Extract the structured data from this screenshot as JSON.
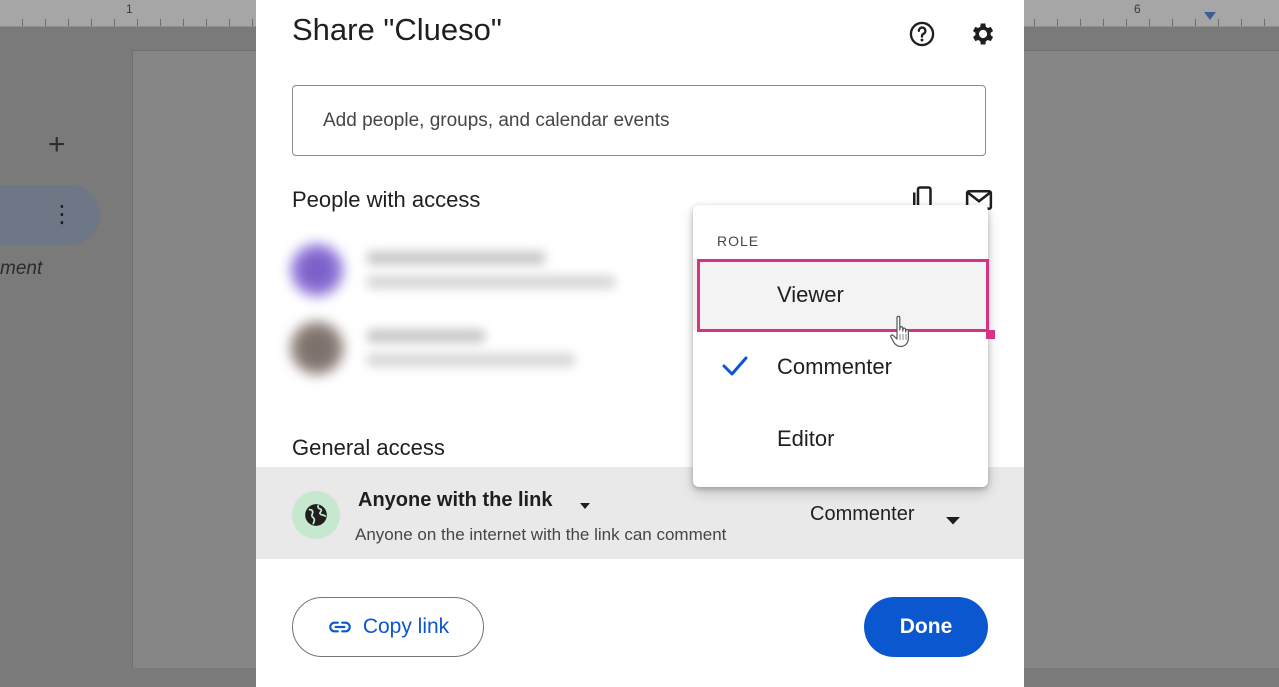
{
  "background": {
    "ruler": {
      "left_number": "1",
      "right_number": "6"
    },
    "comment_text": "ment"
  },
  "dialog": {
    "title": "Share \"Clueso\"",
    "help_icon": "help-circle-icon",
    "settings_icon": "gear-icon",
    "add_people_placeholder": "Add people, groups, and calendar events",
    "people_section_title": "People with access",
    "general_section_title": "General access",
    "general_access": {
      "type_label": "Anyone with the link",
      "description": "Anyone on the internet with the link can comment",
      "role_label": "Commenter"
    },
    "copy_link_label": "Copy link",
    "done_label": "Done"
  },
  "role_menu": {
    "header": "ROLE",
    "items": [
      {
        "label": "Viewer",
        "checked": false,
        "hovered": true
      },
      {
        "label": "Commenter",
        "checked": true,
        "hovered": false
      },
      {
        "label": "Editor",
        "checked": false,
        "hovered": false
      }
    ]
  },
  "colors": {
    "primary": "#0b57d0",
    "highlight": "#d63384",
    "globe_bg": "#c5e8cf",
    "access_row_bg": "#e9e9e9"
  }
}
